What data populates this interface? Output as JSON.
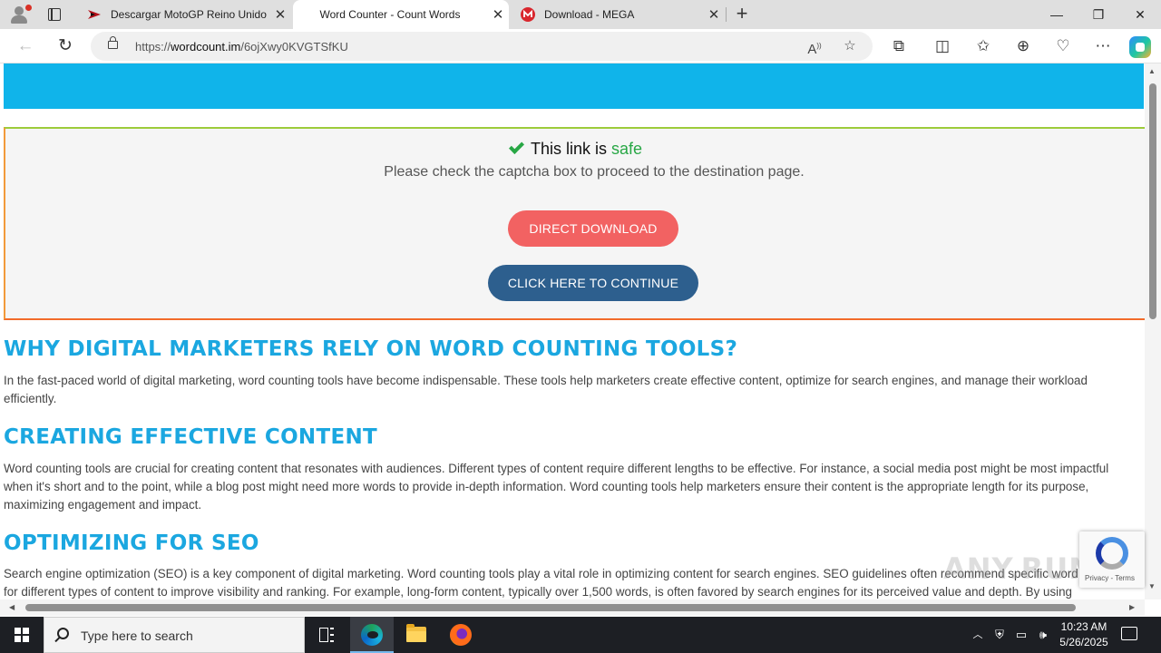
{
  "browser": {
    "tabs": [
      {
        "title": "Descargar MotoGP Reino Unido (",
        "active": false
      },
      {
        "title": "Word Counter - Count Words",
        "active": true
      },
      {
        "title": "Download - MEGA",
        "active": false
      }
    ],
    "url_prefix": "https://",
    "url_domain": "wordcount.im",
    "url_path": "/6ojXwy0KVGTSfKU",
    "colors": {
      "tabstrip": "#dfdfdf",
      "accent": "#10b4ea"
    }
  },
  "page": {
    "safe_prefix": "This link is",
    "safe_word": "safe",
    "captcha_message": "Please check the captcha box to proceed to the destination page.",
    "direct_download_label": "DIRECT DOWNLOAD",
    "continue_label": "CLICK HERE TO CONTINUE",
    "sections": [
      {
        "heading": "WHY DIGITAL MARKETERS RELY ON WORD COUNTING TOOLS?",
        "lines": [
          "In the fast-paced world of digital marketing, word counting tools have become indispensable. These tools help marketers create effective content, optimize for search engines, and manage their workload",
          "efficiently."
        ]
      },
      {
        "heading": "CREATING EFFECTIVE CONTENT",
        "lines": [
          "Word counting tools are crucial for creating content that resonates with audiences. Different types of content require different lengths to be effective. For instance, a social media post might be most impactful",
          "when it's short and to the point, while a blog post might need more words to provide in-depth information. Word counting tools help marketers ensure their content is the appropriate length for its purpose,",
          "maximizing engagement and impact."
        ]
      },
      {
        "heading": "OPTIMIZING FOR SEO",
        "lines": [
          "Search engine optimization (SEO) is a key component of digital marketing. Word counting tools play a vital role in optimizing content for search engines. SEO guidelines often recommend specific word counts",
          "for different types of content to improve visibility and ranking. For example, long-form content, typically over 1,500 words, is often favored by search engines for its perceived value and depth. By using"
        ]
      }
    ],
    "recaptcha_terms": "Privacy - Terms",
    "watermark": "ANY.RUN",
    "colors": {
      "heading": "#1ba7e0",
      "safe": "#28a745",
      "direct_download": "#f26262",
      "continue": "#2d5f8e"
    }
  },
  "taskbar": {
    "search_placeholder": "Type here to search",
    "time": "10:23 AM",
    "date": "5/26/2025"
  }
}
